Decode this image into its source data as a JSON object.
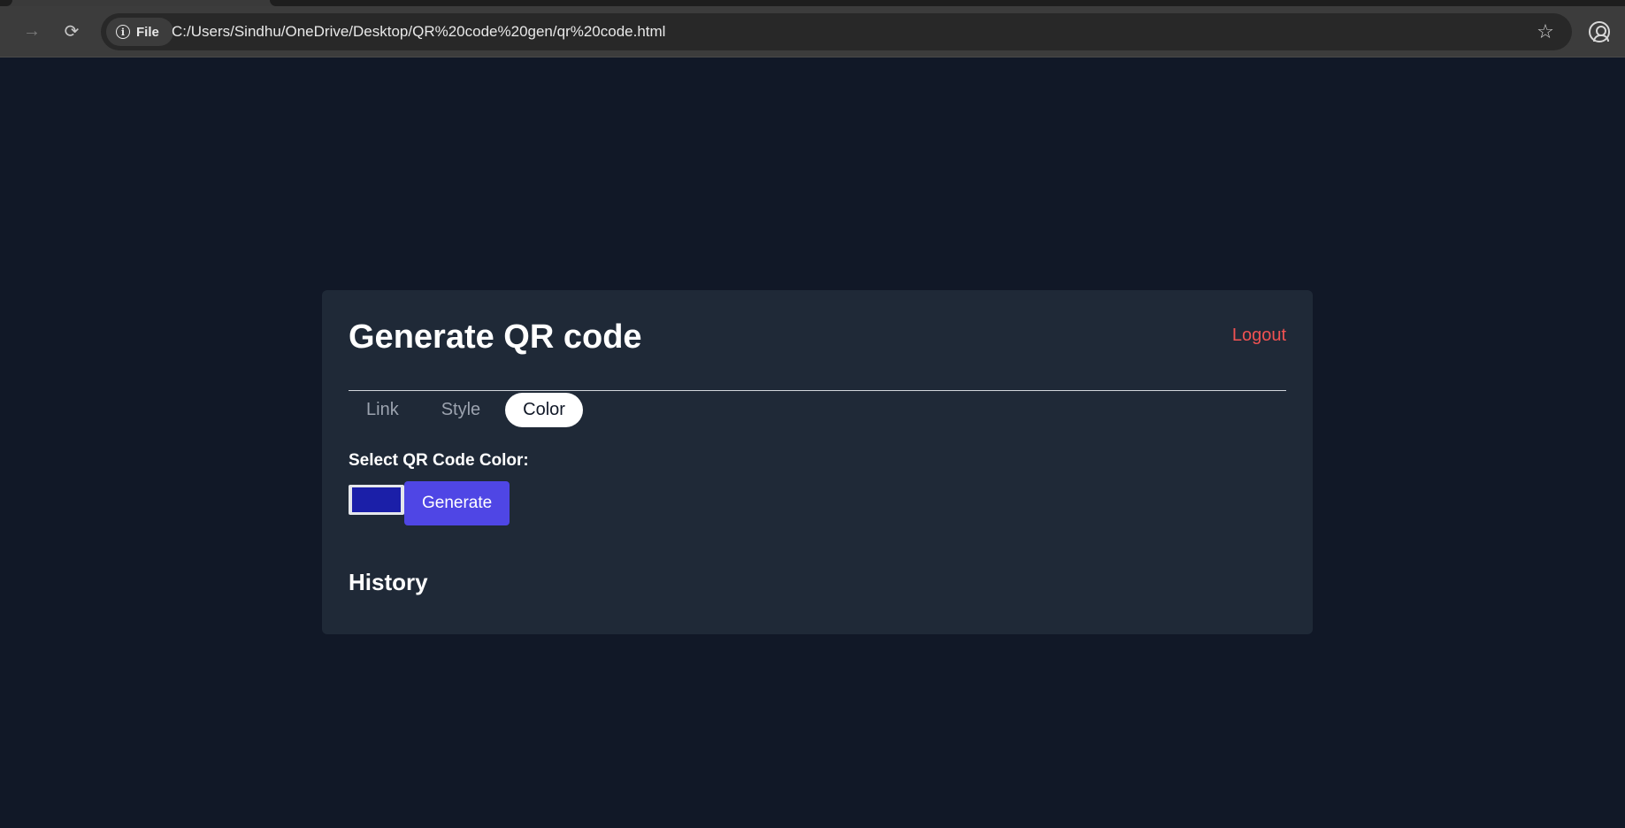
{
  "browser": {
    "site_chip_label": "File",
    "url": "C:/Users/Sindhu/OneDrive/Desktop/QR%20code%20gen/qr%20code.html"
  },
  "page": {
    "title": "Generate QR code",
    "logout_label": "Logout",
    "tabs": [
      {
        "label": "Link",
        "active": false
      },
      {
        "label": "Style",
        "active": false
      },
      {
        "label": "Color",
        "active": true
      }
    ],
    "color_field_label": "Select QR Code Color:",
    "selected_color": "#1b1fa8",
    "generate_label": "Generate",
    "history_heading": "History"
  },
  "colors": {
    "page_background": "#111827",
    "card_background": "#1f2937",
    "accent": "#4f46e5",
    "logout": "#f05252"
  }
}
